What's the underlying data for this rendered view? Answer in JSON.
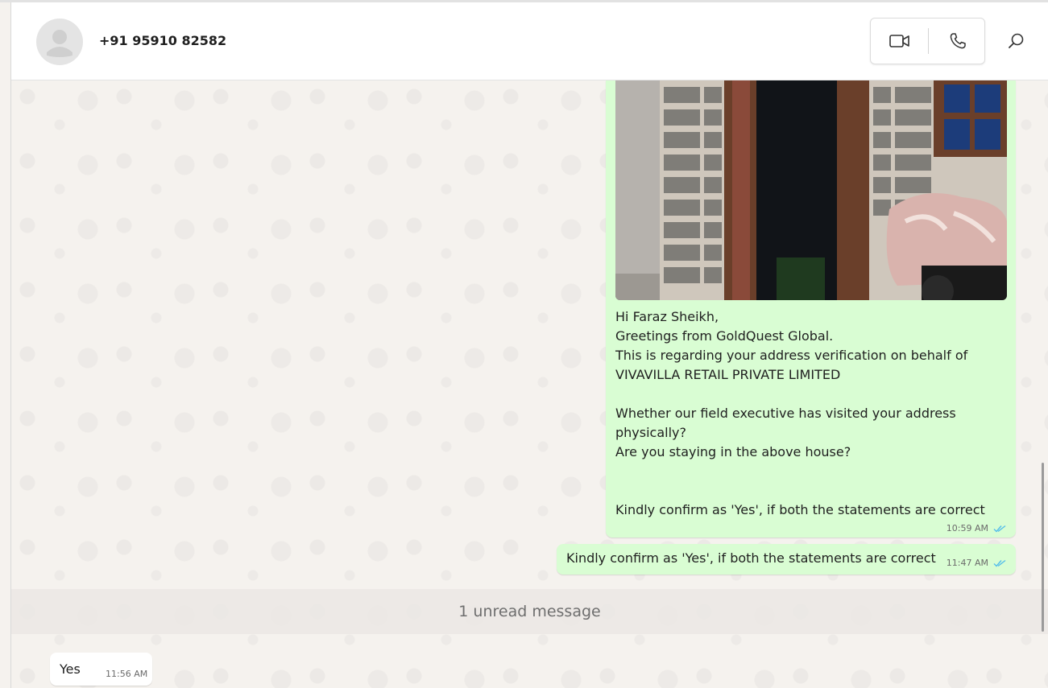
{
  "header": {
    "contact_name": "+91 95910 82582",
    "icons": {
      "video": "video-camera-icon",
      "phone": "phone-icon",
      "search": "search-icon"
    }
  },
  "messages": {
    "outgoing_main": {
      "text": "Hi Faraz Sheikh,\nGreetings from GoldQuest Global.\nThis is regarding your address verification on behalf of VIVAVILLA RETAIL PRIVATE LIMITED\n\nWhether our field executive has visited your address physically?\nAre you staying in the above house?\n\n\nKindly confirm as 'Yes', if both the statements are correct",
      "time": "10:59 AM"
    },
    "outgoing_followup": {
      "text": "Kindly confirm as 'Yes', if both the statements are correct",
      "time": "11:47 AM"
    },
    "unread_label": "1 unread message",
    "incoming": {
      "text": "Yes",
      "time": "11:56 AM"
    }
  },
  "colors": {
    "outgoing_bubble": "#d9fdd3",
    "read_tick": "#53bdeb",
    "chat_bg": "#f5f2ee"
  }
}
